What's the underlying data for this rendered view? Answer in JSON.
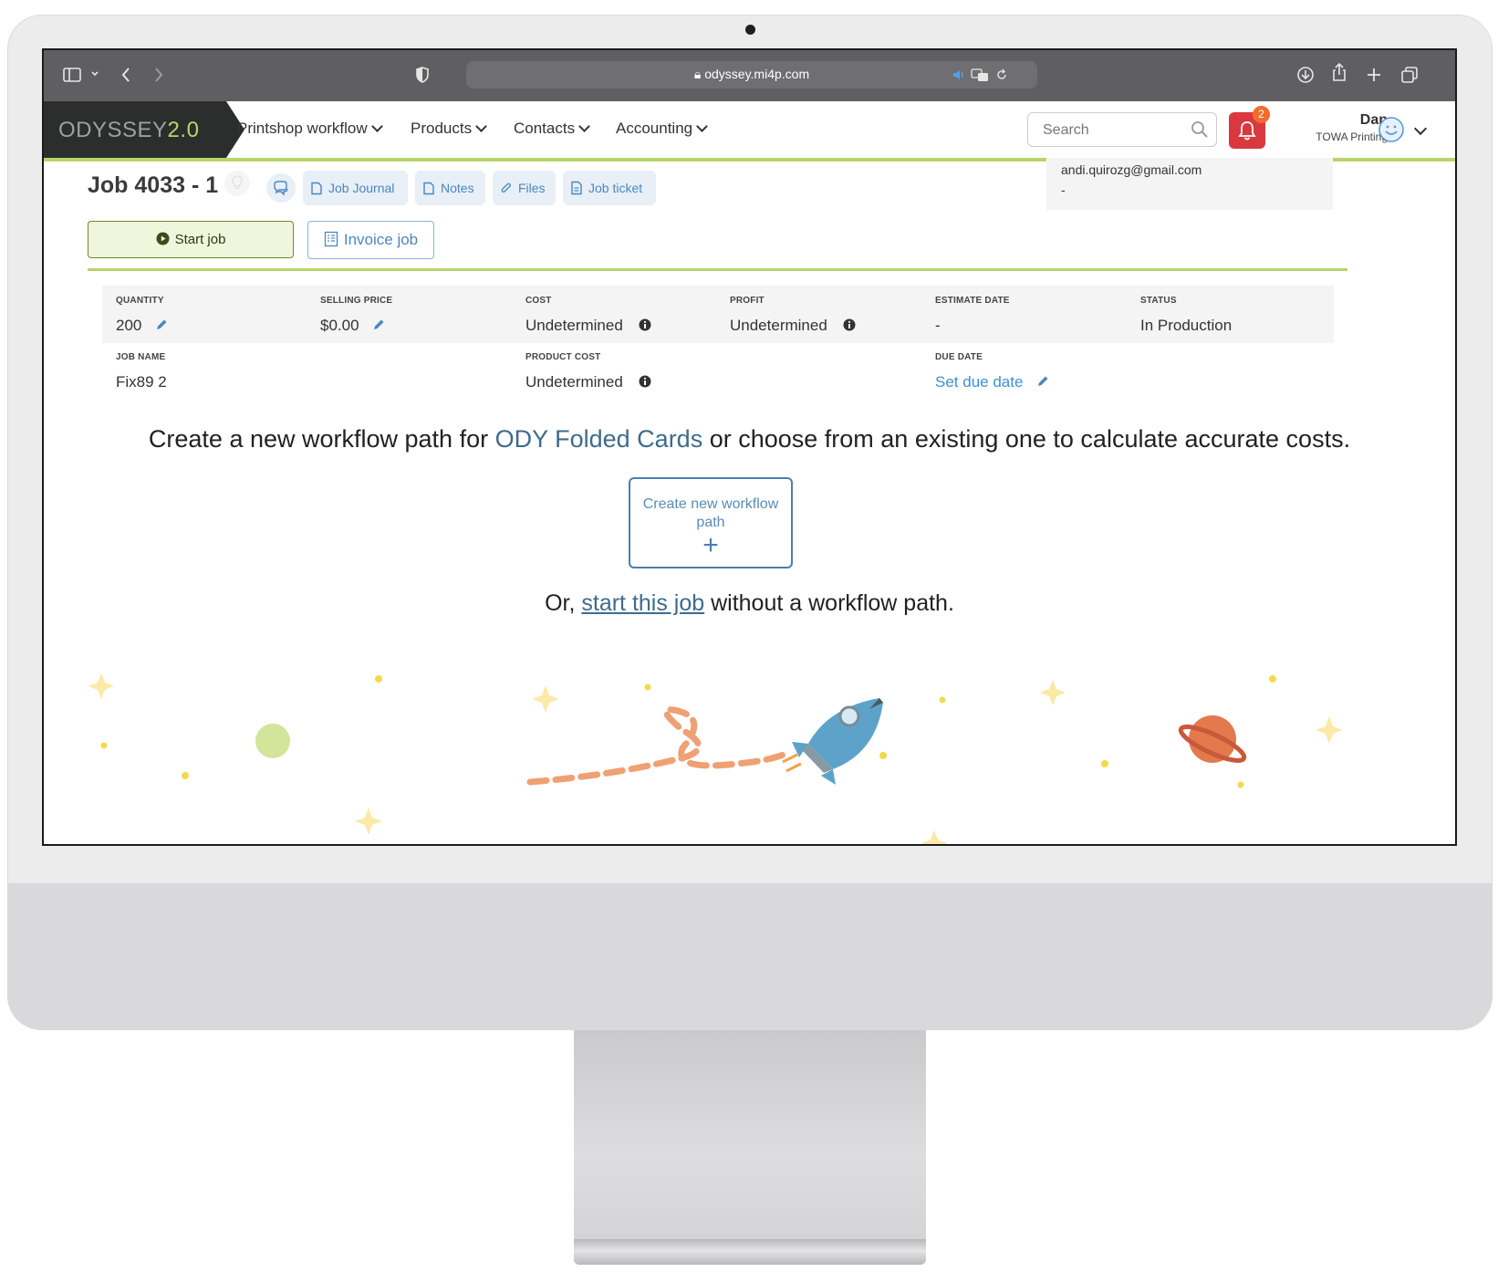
{
  "browser": {
    "url": "odyssey.mi4p.com",
    "icons": [
      "sidebar-icon",
      "chevron-down-icon",
      "back-icon",
      "forward-icon",
      "shield-icon",
      "lock-icon",
      "speaker-icon",
      "translate-icon",
      "reload-icon",
      "download-icon",
      "share-icon",
      "new-tab-icon",
      "tabs-overview-icon"
    ]
  },
  "app": {
    "logo": "ODYSSEY",
    "logo_version": "2.0",
    "nav": [
      {
        "label": "Printshop workflow"
      },
      {
        "label": "Products"
      },
      {
        "label": "Contacts"
      },
      {
        "label": "Accounting"
      }
    ],
    "search_placeholder": "Search",
    "notifications_count": "2",
    "user": {
      "name": "Dan",
      "company": "TOWA Printing"
    },
    "accent_color": "#b8d56a",
    "alert_color": "#d9383f"
  },
  "job": {
    "title": "Job 4033 - 1",
    "tabs": [
      {
        "label": "Job Journal",
        "icon": "journal-icon"
      },
      {
        "label": "Notes",
        "icon": "notes-icon"
      },
      {
        "label": "Files",
        "icon": "paperclip-icon"
      },
      {
        "label": "Job ticket",
        "icon": "ticket-icon"
      }
    ],
    "contact_email": "andi.quirozg@gmail.com",
    "contact_extra": "-",
    "start_button": "Start job",
    "invoice_button": "Invoice job"
  },
  "metrics": {
    "quantity": {
      "label": "QUANTITY",
      "value": "200"
    },
    "selling_price": {
      "label": "SELLING PRICE",
      "value": "$0.00"
    },
    "cost": {
      "label": "COST",
      "value": "Undetermined"
    },
    "profit": {
      "label": "PROFIT",
      "value": "Undetermined"
    },
    "estimate_date": {
      "label": "ESTIMATE DATE",
      "value": "-"
    },
    "status": {
      "label": "STATUS",
      "value": "In Production"
    },
    "job_name": {
      "label": "JOB NAME",
      "value": "Fix89 2"
    },
    "product_cost": {
      "label": "PRODUCT COST",
      "value": "Undetermined"
    },
    "due_date": {
      "label": "DUE DATE",
      "value": "Set due date"
    }
  },
  "workflow": {
    "prompt_before": "Create a new workflow path for ",
    "product": "ODY Folded Cards",
    "prompt_after": " or choose from an existing one to calculate accurate costs.",
    "create_button": "Create new workflow path",
    "or_before": "Or, ",
    "or_link": "start this job",
    "or_after": " without a workflow path."
  }
}
